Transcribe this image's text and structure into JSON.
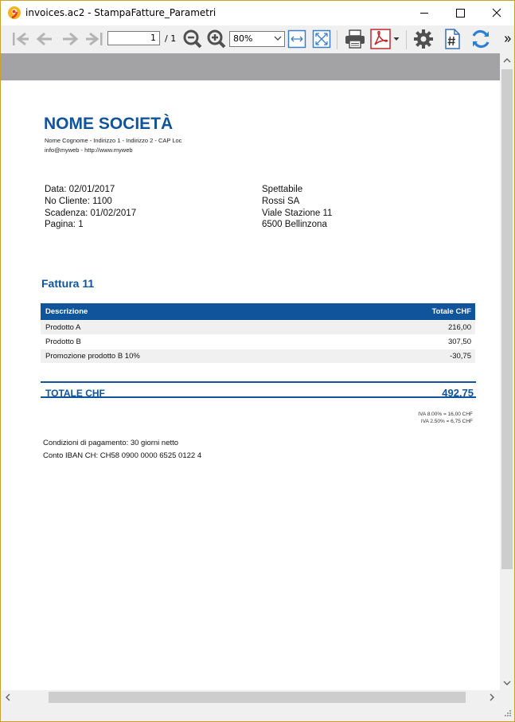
{
  "window": {
    "title": "invoices.ac2 - StampaFatture_Parametri"
  },
  "toolbar": {
    "page_current": "1",
    "page_total": "/ 1",
    "zoom": "80%"
  },
  "invoice": {
    "company_name": "NOME SOCIETÀ",
    "company_address": "Nome Cognome - Indirizzo 1 - Indirizzo 2 - CAP Loc",
    "company_web": "info@myweb - http://www.myweb",
    "meta": [
      "Data: 02/01/2017",
      "No Cliente: 1100",
      "Scadenza: 01/02/2017",
      "Pagina: 1"
    ],
    "recipient": [
      "Spettabile",
      "Rossi SA",
      "Viale Stazione 11",
      "6500 Bellinzona"
    ],
    "title": "Fattura 11",
    "table": {
      "header_desc": "Descrizione",
      "header_total": "Totale CHF",
      "rows": [
        {
          "desc": "Prodotto A",
          "value": "216,00"
        },
        {
          "desc": "Prodotto B",
          "value": "307,50"
        },
        {
          "desc": "Promozione prodotto B 10%",
          "value": "-30,75"
        }
      ]
    },
    "total_label": "TOTALE CHF",
    "total_value": "492,75",
    "vat": [
      "IVA 8.00% = 16,00 CHF",
      "IVA 2.50% = 6,75 CHF"
    ],
    "payment_terms": "Condizioni di pagamento: 30 giorni netto",
    "iban": "Conto IBAN CH: CH58 0900 0000 6525 0122 4"
  },
  "icons": {
    "back_first": "first-page-icon",
    "back": "previous-page-icon",
    "forward": "next-page-icon",
    "forward_last": "last-page-icon",
    "zoom_out": "zoom-out-icon",
    "zoom_in": "zoom-in-icon",
    "fit_width": "fit-width-icon",
    "fit_page": "fit-page-icon",
    "print": "printer-icon",
    "pdf": "pdf-icon",
    "settings": "gear-icon",
    "page_number": "page-number-icon",
    "refresh": "refresh-icon",
    "more": "more-icon"
  },
  "colors": {
    "accent": "#10549c",
    "pdf_red": "#c0282d"
  }
}
